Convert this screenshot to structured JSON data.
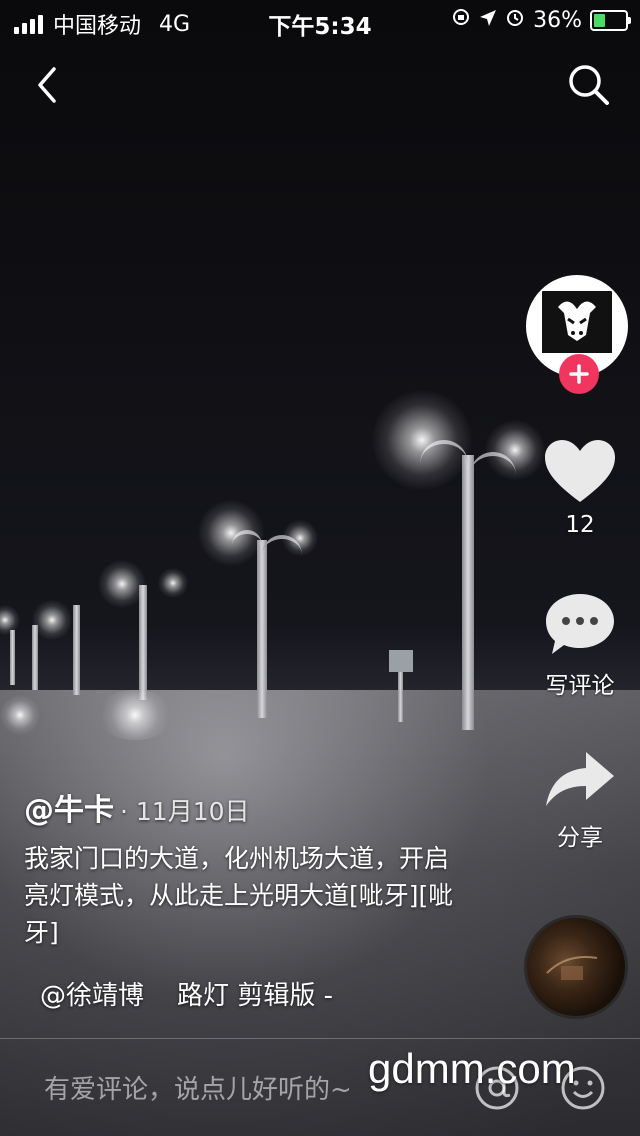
{
  "status_bar": {
    "carrier": "中国移动",
    "network": "4G",
    "time": "下午5:34",
    "battery": "36%",
    "battery_level": 0.36
  },
  "nav": {
    "back_icon": "chevron-left-icon",
    "search_icon": "search-icon"
  },
  "side_actions": {
    "likes": "12",
    "comment_label": "写评论",
    "share_label": "分享"
  },
  "post": {
    "author": "@牛卡",
    "date": "· 11月10日",
    "caption": "我家门口的大道，化州机场大道，开启亮灯模式，从此走上光明大道[呲牙][呲牙]",
    "music": "@徐靖博    路灯 剪辑版 -"
  },
  "comment_bar": {
    "placeholder": "有爱评论，说点儿好听的~"
  },
  "watermark": "gdmm.com",
  "colors": {
    "follow": "#f0365f",
    "battery_fill": "#4cd964"
  }
}
